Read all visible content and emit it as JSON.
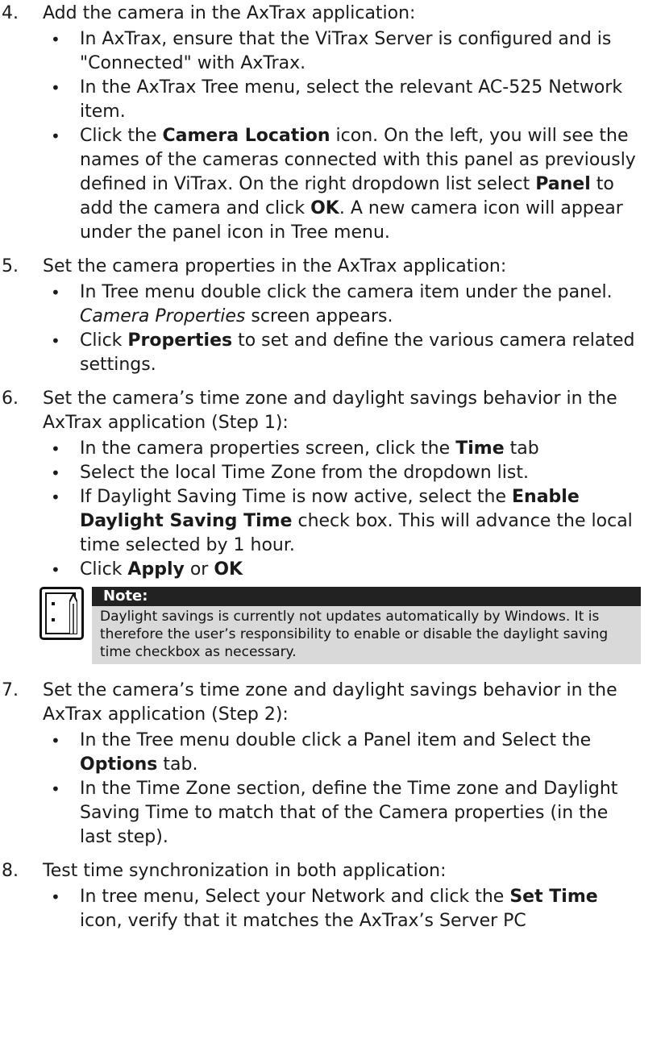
{
  "steps": [
    {
      "number": "4.",
      "title": "Add the camera in the AxTrax application:",
      "bullets": [
        {
          "t1": "In AxTrax, ensure that the ViTrax Server is configured and is \"Connected\" with AxTrax."
        },
        {
          "t1": "In the AxTrax Tree menu, select the relevant AC-525 Network item."
        },
        {
          "t1": "Click the ",
          "b1": "Camera Location",
          "t2": " icon. On the left, you will see the names of the cameras connected with this panel as previously defined in ViTrax. On the right dropdown list select ",
          "b2": "Panel",
          "t3": " to add the camera and click ",
          "b3": "OK",
          "t4": ". A new camera icon will appear under the panel icon in Tree menu."
        }
      ]
    },
    {
      "number": "5.",
      "title": "Set the camera properties in the AxTrax application:",
      "bullets": [
        {
          "t1": "In Tree menu double click the camera item under the panel. ",
          "i1": "Camera Properties",
          "t2": " screen appears."
        },
        {
          "t1": "Click ",
          "b1": "Properties",
          "t2": " to set and define the various camera related settings."
        }
      ]
    },
    {
      "number": "6.",
      "title": "Set the camera’s time zone and daylight savings behavior in the AxTrax application (Step 1):",
      "bullets": [
        {
          "t1": "In the camera properties screen, click the ",
          "b1": "Time",
          "t2": " tab"
        },
        {
          "t1": "Select the local Time Zone from the dropdown list."
        },
        {
          "t1": "If Daylight Saving Time is now active, select the ",
          "b1": "Enable Daylight Saving Time",
          "t2": " check box. This will advance the local time selected by 1 hour."
        },
        {
          "t1": "Click ",
          "b1": "Apply",
          "t2": " or ",
          "b2": "OK"
        }
      ],
      "note": {
        "heading": "Note:",
        "text": "Daylight savings is currently not updates automatically by Windows. It is therefore the user’s responsibility to enable or disable the daylight saving time checkbox as necessary."
      }
    },
    {
      "number": "7.",
      "title": "Set the camera’s time zone and daylight savings behavior in the AxTrax application (Step 2):",
      "bullets": [
        {
          "t1": "In the Tree menu double click a Panel item and Select the ",
          "b1": "Options",
          "t2": " tab."
        },
        {
          "t1": "In the Time Zone section, define the Time zone and Daylight Saving Time to match that of the Camera properties (in the last step)."
        }
      ]
    },
    {
      "number": "8.",
      "title": "Test time synchronization in both application:",
      "bullets": [
        {
          "t1": "In tree menu, Select your Network and click the ",
          "b1": "Set Time",
          "t2": " icon, verify that it matches the AxTrax’s Server PC"
        }
      ]
    }
  ]
}
